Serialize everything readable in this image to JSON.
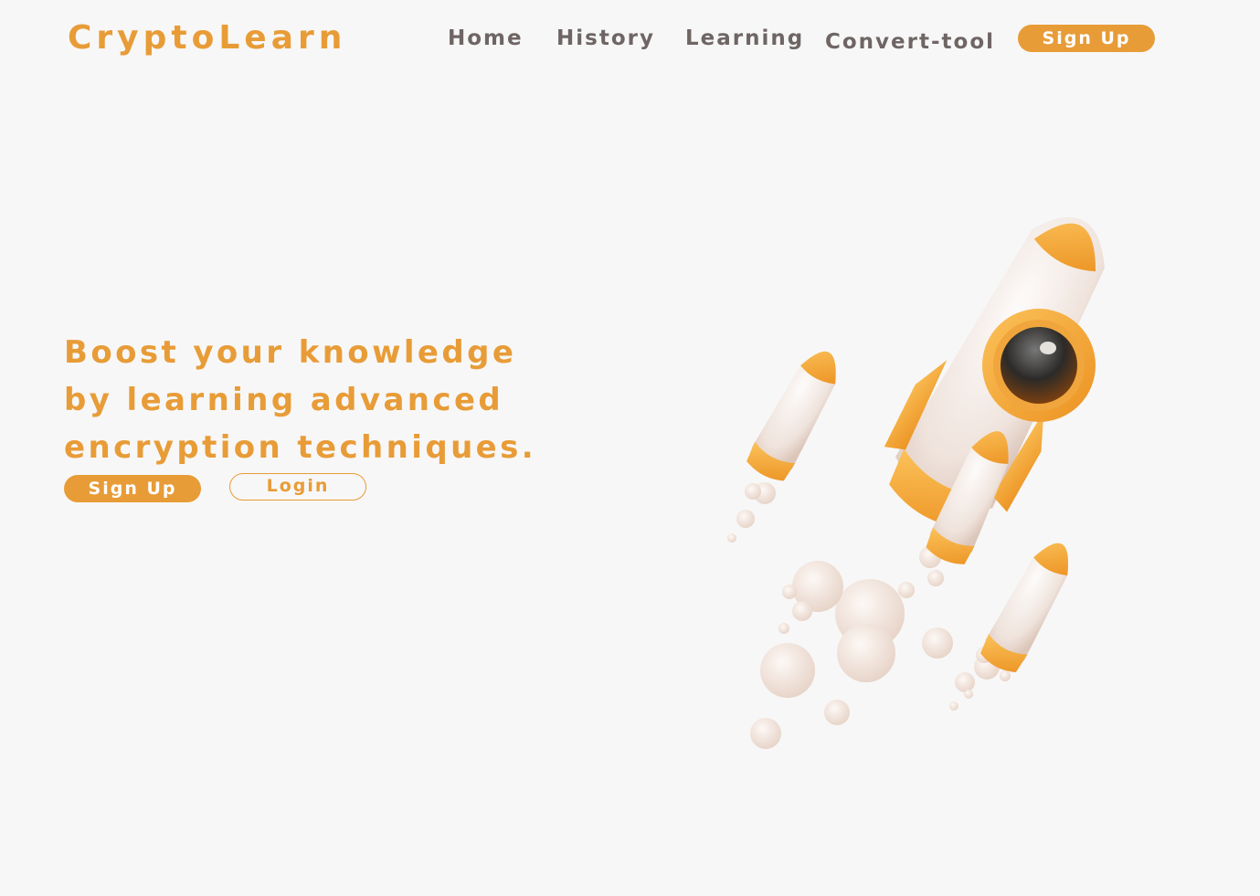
{
  "header": {
    "logo": "CryptoLearn",
    "nav": {
      "home": "Home",
      "history": "History",
      "learning": "Learning",
      "convert_tool": "Convert-tool"
    },
    "signup_label": "Sign Up"
  },
  "hero": {
    "headline": "Boost your knowledge by learning advanced encryption techniques.",
    "signup_label": "Sign Up",
    "login_label": "Login",
    "illustration": "rocket-illustration"
  },
  "colors": {
    "accent": "#e89c37",
    "nav_text": "#6f6565",
    "background": "#f7f7f7"
  }
}
